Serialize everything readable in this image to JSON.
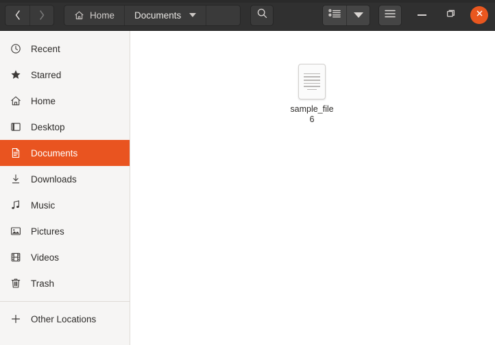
{
  "window": {
    "title": "Documents",
    "controls": {
      "minimize_label": "Minimize",
      "maximize_label": "Restore",
      "close_label": "Close"
    }
  },
  "headerbar": {
    "back_label": "Back",
    "forward_label": "Forward",
    "pathbar": [
      {
        "label": "Home",
        "icon": "home-icon",
        "current": false
      },
      {
        "label": "Documents",
        "icon": "chevron-down-icon",
        "current": true
      }
    ],
    "search_label": "Search",
    "view_list_label": "List view",
    "view_options_label": "View options",
    "menu_label": "Main menu"
  },
  "sidebar": {
    "items": [
      {
        "label": "Recent",
        "icon": "clock-icon",
        "selected": false
      },
      {
        "label": "Starred",
        "icon": "star-icon",
        "selected": false
      },
      {
        "label": "Home",
        "icon": "home-icon",
        "selected": false
      },
      {
        "label": "Desktop",
        "icon": "desktop-icon",
        "selected": false
      },
      {
        "label": "Documents",
        "icon": "document-icon",
        "selected": true
      },
      {
        "label": "Downloads",
        "icon": "download-icon",
        "selected": false
      },
      {
        "label": "Music",
        "icon": "music-icon",
        "selected": false
      },
      {
        "label": "Pictures",
        "icon": "picture-icon",
        "selected": false
      },
      {
        "label": "Videos",
        "icon": "video-icon",
        "selected": false
      },
      {
        "label": "Trash",
        "icon": "trash-icon",
        "selected": false
      }
    ],
    "other_locations": {
      "label": "Other Locations",
      "icon": "plus-icon"
    }
  },
  "files": [
    {
      "name": "sample_file6",
      "type": "text-document"
    }
  ],
  "colors": {
    "accent": "#e95420",
    "header_bg": "#303030",
    "sidebar_bg": "#f6f5f4",
    "content_bg": "#ffffff"
  }
}
